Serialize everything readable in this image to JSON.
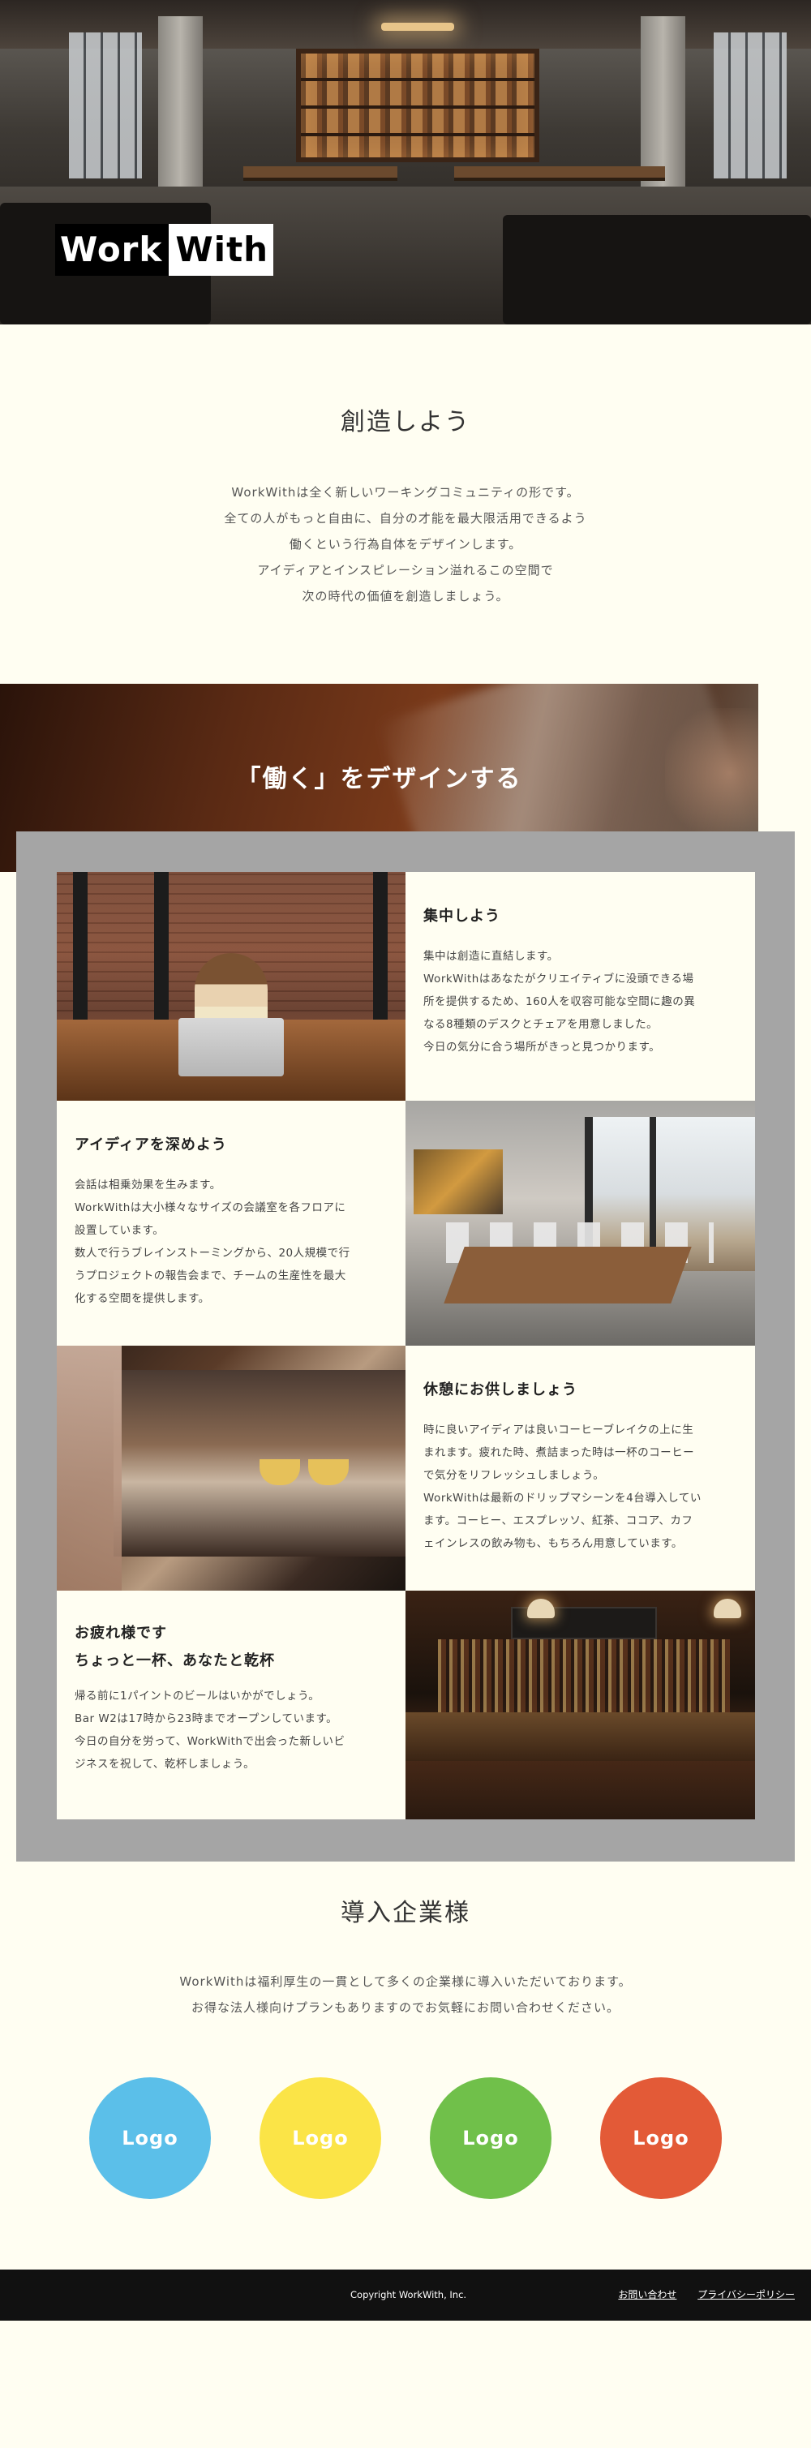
{
  "hero": {
    "logo_left": "Work",
    "logo_right": "With"
  },
  "intro": {
    "title": "創造しよう",
    "lines": [
      "WorkWithは全く新しいワーキングコミュニティの形です。",
      "全ての人がもっと自由に、自分の才能を最大限活用できるよう",
      "働くという行為自体をデザインします。",
      "アイディアとインスピレーション溢れるこの空間で",
      "次の時代の価値を創造しましょう。"
    ]
  },
  "design": {
    "title": "「働く」をデザインする"
  },
  "features": [
    {
      "title_lines": [
        "集中しよう"
      ],
      "body": [
        "集中は創造に直結します。",
        "WorkWithはあなたがクリエイティブに没頭できる場",
        "所を提供するため、160人を収容可能な空間に趣の異",
        "なる8種類のデスクとチェアを用意しました。",
        "今日の気分に合う場所がきっと見つかります。"
      ]
    },
    {
      "title_lines": [
        "アイディアを深めよう"
      ],
      "body": [
        "会話は相乗効果を生みます。",
        "WorkWithは大小様々なサイズの会議室を各フロアに",
        "設置しています。",
        "数人で行うブレインストーミングから、20人規模で行",
        "うプロジェクトの報告会まで、チームの生産性を最大",
        "化する空間を提供します。"
      ]
    },
    {
      "title_lines": [
        "休憩にお供しましょう"
      ],
      "body": [
        "時に良いアイディアは良いコーヒーブレイクの上に生",
        "まれます。疲れた時、煮詰まった時は一杯のコーヒー",
        "で気分をリフレッシュしましょう。",
        "WorkWithは最新のドリップマシーンを4台導入してい",
        "ます。コーヒー、エスプレッソ、紅茶、ココア、カフ",
        "ェインレスの飲み物も、もちろん用意しています。"
      ]
    },
    {
      "title_lines": [
        "お疲れ様です",
        "ちょっと一杯、あなたと乾杯"
      ],
      "body": [
        "帰る前に1パイントのビールはいかがでしょう。",
        "Bar W2は17時から23時までオープンしています。",
        "今日の自分を労って、WorkWithで出会った新しいビ",
        "ジネスを祝して、乾杯しましょう。"
      ]
    }
  ],
  "clients": {
    "title": "導入企業様",
    "lines": [
      "WorkWithは福利厚生の一貫として多くの企業様に導入いただいております。",
      "お得な法人様向けプランもありますのでお気軽にお問い合わせください。"
    ],
    "logos": [
      {
        "label": "Logo",
        "color": "#5bbfe9"
      },
      {
        "label": "Logo",
        "color": "#fbe447"
      },
      {
        "label": "Logo",
        "color": "#70c04a"
      },
      {
        "label": "Logo",
        "color": "#e35a37"
      }
    ]
  },
  "footer": {
    "copyright": "Copyright WorkWith, Inc.",
    "links": [
      "お問い合わせ",
      "プライバシーポリシー"
    ]
  }
}
